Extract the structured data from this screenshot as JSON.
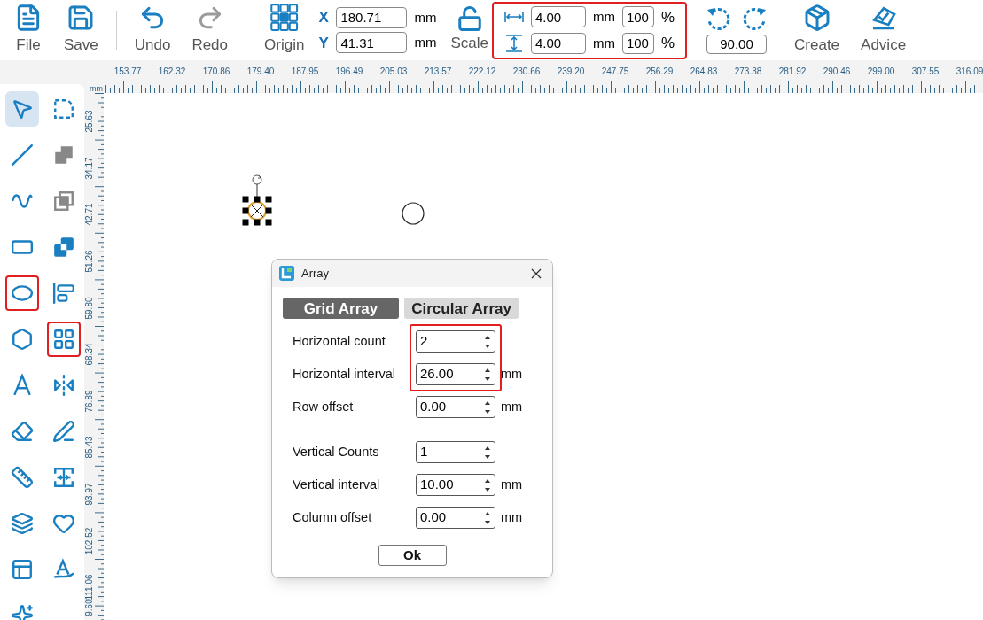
{
  "toolbar": {
    "left_buttons": [
      {
        "kind": "file",
        "label": "File"
      },
      {
        "kind": "save",
        "label": "Save"
      },
      {
        "kind": "sep"
      },
      {
        "kind": "undo",
        "label": "Undo",
        "disabled": false
      },
      {
        "kind": "redo",
        "label": "Redo",
        "disabled": true
      },
      {
        "kind": "sep"
      },
      {
        "kind": "origin",
        "label": "Origin"
      }
    ],
    "position": [
      {
        "axis": "X",
        "value": "180.71",
        "unit": "mm"
      },
      {
        "axis": "Y",
        "value": "41.31",
        "unit": "mm"
      }
    ],
    "scale_button": {
      "label": "Scale"
    },
    "size": {
      "highlighted": true,
      "rows": [
        {
          "kind": "width",
          "value": "4.00",
          "unit": "mm",
          "percent": "100",
          "percent_sign": "%"
        },
        {
          "kind": "height",
          "value": "4.00",
          "unit": "mm",
          "percent": "100",
          "percent_sign": "%"
        }
      ]
    },
    "rotation": {
      "value": "90.00"
    },
    "right_buttons": [
      {
        "kind": "create",
        "label": "Create"
      },
      {
        "kind": "advice",
        "label": "Advice"
      }
    ]
  },
  "tools": [
    {
      "selected": true,
      "highlighted": false
    },
    {
      "selected": false,
      "highlighted": false
    },
    {
      "selected": false,
      "highlighted": false
    },
    {
      "selected": false,
      "highlighted": false
    },
    {
      "selected": false,
      "highlighted": false
    },
    {
      "selected": false,
      "highlighted": false
    },
    {
      "selected": false,
      "highlighted": false
    },
    {
      "selected": false,
      "highlighted": false
    },
    {
      "selected": false,
      "highlighted": true
    },
    {
      "selected": false,
      "highlighted": false
    },
    {
      "selected": false,
      "highlighted": false
    },
    {
      "selected": false,
      "highlighted": true
    },
    {
      "selected": false,
      "highlighted": false
    },
    {
      "selected": false,
      "highlighted": false
    },
    {
      "selected": false,
      "highlighted": false
    },
    {
      "selected": false,
      "highlighted": false
    },
    {
      "selected": false,
      "highlighted": false
    },
    {
      "selected": false,
      "highlighted": false
    },
    {
      "selected": false,
      "highlighted": false
    },
    {
      "selected": false,
      "highlighted": false
    },
    {
      "selected": false,
      "highlighted": false
    },
    {
      "selected": false,
      "highlighted": false
    },
    {
      "selected": false,
      "highlighted": false
    }
  ],
  "ruler": {
    "unit": "mm",
    "top_labels": [
      "153.77",
      "162.32",
      "170.86",
      "179.40",
      "187.95",
      "196.49",
      "205.03",
      "213.57",
      "222.12",
      "230.66",
      "239.20",
      "247.75",
      "256.29",
      "264.83",
      "273.38",
      "281.92",
      "290.46",
      "299.00",
      "307.55",
      "316.09"
    ],
    "left_labels": [
      "25.63",
      "34.17",
      "42.71",
      "51.26",
      "59.80",
      "68.34",
      "76.89",
      "85.43",
      "93.97",
      "102.52",
      "111.06",
      "9.60"
    ]
  },
  "dialog": {
    "title": "Array",
    "tabs": [
      {
        "label": "Grid Array",
        "selected": true
      },
      {
        "label": "Circular Array",
        "selected": false
      }
    ],
    "groups": [
      [
        {
          "highlighted": true,
          "fields": [
            {
              "label": "Horizontal count",
              "value": "2"
            },
            {
              "label": "Horizontal interval",
              "value": "26.00",
              "unit": "mm"
            }
          ]
        },
        {
          "highlighted": false,
          "fields": [
            {
              "label": "Row offset",
              "value": "0.00",
              "unit": "mm"
            }
          ]
        }
      ],
      [
        {
          "highlighted": false,
          "fields": [
            {
              "label": "Vertical Counts",
              "value": "1"
            },
            {
              "label": "Vertical interval",
              "value": "10.00",
              "unit": "mm"
            },
            {
              "label": "Column offset",
              "value": "0.00",
              "unit": "mm"
            }
          ]
        }
      ]
    ],
    "ok_button": "Ok"
  }
}
